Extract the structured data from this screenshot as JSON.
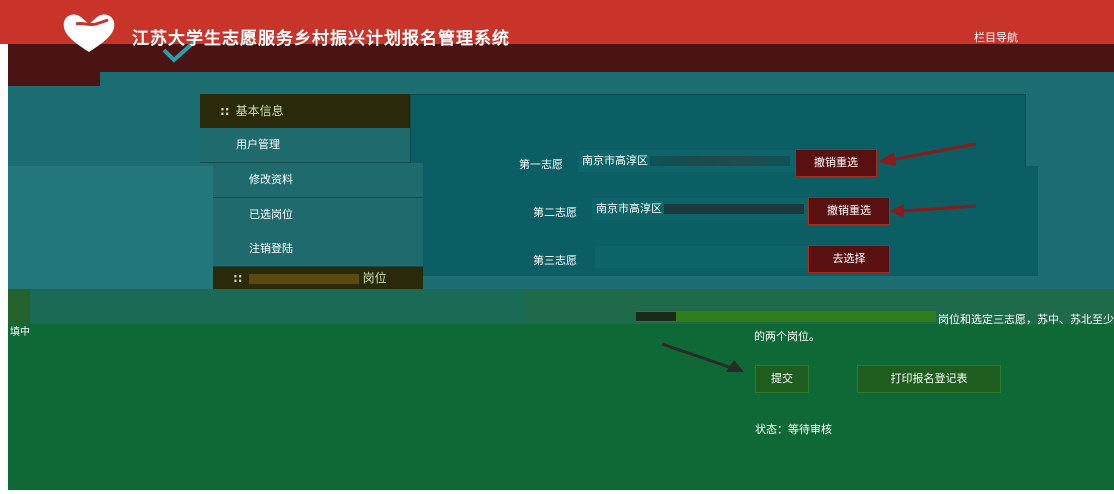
{
  "header": {
    "title": "江苏大学生志愿服务乡村振兴计划报名管理系统",
    "nav_link": "栏目导航"
  },
  "sidebar": {
    "section_basic": "基本信息",
    "section_dots": "::",
    "items": [
      {
        "label": "用户管理"
      },
      {
        "label": "修改资料"
      },
      {
        "label": "已选岗位"
      },
      {
        "label": "注销登陆"
      }
    ],
    "section_second": "岗位"
  },
  "wishes": [
    {
      "label": "第一志愿",
      "value": "南京市高淳区",
      "button": "撤销重选"
    },
    {
      "label": "第二志愿",
      "value": "南京市高淳区",
      "button": "撤销重选"
    },
    {
      "label": "第三志愿",
      "value": "",
      "button": "去选择"
    }
  ],
  "left_partial_text": "填中",
  "notice": {
    "line1_tail": "岗位和选定三志愿，苏中、苏北至少选",
    "line2": "的两个岗位。"
  },
  "actions": {
    "submit": "提交",
    "print": "打印报名登记表"
  },
  "status": {
    "label": "状态：",
    "value": "等待审核"
  },
  "colors": {
    "header_red": "#c8332a",
    "accent_arrow": "#8b1a1a",
    "teal": "#1c6e72",
    "green": "#0f6936"
  }
}
